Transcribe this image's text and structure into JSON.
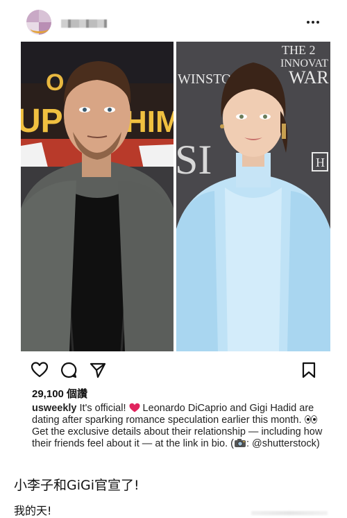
{
  "post": {
    "more_icon": "ellipsis-icon",
    "likes_label": "29,100 個讚",
    "caption": {
      "username": "usweekly",
      "segments": [
        " It's official! ",
        " Leonardo DiCaprio and Gigi Hadid are dating after sparking romance speculation earlier this month. ",
        " Get the exclusive details about their relationship — including how their friends feel about it — at the link in bio. (",
        ": @shutterstock)"
      ],
      "emoji": [
        "red-heart-icon",
        "eyes-icon",
        "camera-icon"
      ]
    },
    "photos": {
      "left": {
        "backdrop_text": [
          "O",
          "UPO",
          "HIM"
        ]
      },
      "right": {
        "backdrop_text": [
          "THE 2",
          "INNOVAT",
          "WAR",
          "WINSTO",
          "SI"
        ],
        "badge": "H"
      }
    },
    "actions": [
      "heart-icon",
      "comment-icon",
      "share-icon",
      "bookmark-icon"
    ]
  },
  "comments": [
    {
      "text": "小李子和GiGi官宣了!"
    },
    {
      "text": "我的天!"
    }
  ],
  "colors": {
    "text": "#111111",
    "red_heart": "#e0245e",
    "left_backdrop": "#1f1d22",
    "right_backdrop": "#49484c",
    "dress": "#bfe2f6"
  }
}
